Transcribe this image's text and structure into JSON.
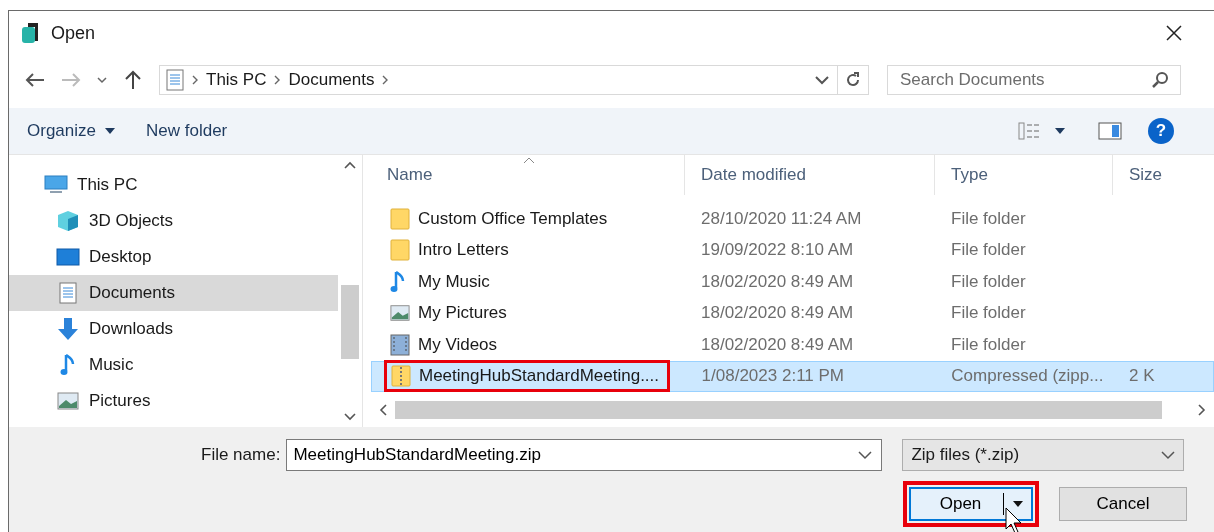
{
  "window": {
    "title": "Open"
  },
  "nav": {
    "breadcrumb": [
      "This PC",
      "Documents"
    ],
    "search": {
      "placeholder": "Search Documents"
    }
  },
  "toolbar": {
    "organize": "Organize",
    "new_folder": "New folder",
    "help": "?"
  },
  "sidebar": {
    "items": [
      {
        "label": "This PC",
        "kind": "pc",
        "selected": false,
        "children": [
          {
            "label": "3D Objects",
            "kind": "cube",
            "selected": false
          },
          {
            "label": "Desktop",
            "kind": "desktop",
            "selected": false
          },
          {
            "label": "Documents",
            "kind": "document",
            "selected": true
          },
          {
            "label": "Downloads",
            "kind": "download",
            "selected": false
          },
          {
            "label": "Music",
            "kind": "music",
            "selected": false
          },
          {
            "label": "Pictures",
            "kind": "pictures",
            "selected": false
          }
        ]
      }
    ]
  },
  "table": {
    "columns": [
      "Name",
      "Date modified",
      "Type",
      "Size"
    ],
    "rows": [
      {
        "name": "Custom Office Templates",
        "date": "28/10/2020 11:24 AM",
        "type": "File folder",
        "kind": "folder",
        "selected": false,
        "highlighted": false
      },
      {
        "name": "Intro Letters",
        "date": "19/09/2022 8:10 AM",
        "type": "File folder",
        "kind": "folder",
        "selected": false,
        "highlighted": false
      },
      {
        "name": "My Music",
        "date": "18/02/2020 8:49 AM",
        "type": "File folder",
        "kind": "music",
        "selected": false,
        "highlighted": false
      },
      {
        "name": "My Pictures",
        "date": "18/02/2020 8:49 AM",
        "type": "File folder",
        "kind": "pictures",
        "selected": false,
        "highlighted": false
      },
      {
        "name": "My Videos",
        "date": "18/02/2020 8:49 AM",
        "type": "File folder",
        "kind": "videos",
        "selected": false,
        "highlighted": false
      },
      {
        "name": "MeetingHubStandardMeeting....",
        "date": "1/08/2023 2:11 PM",
        "type": "Compressed (zipp...",
        "size": "2 K",
        "kind": "zip",
        "selected": true,
        "highlighted": true
      }
    ]
  },
  "footer": {
    "file_name_label": "File name:",
    "file_name": "MeetingHubStandardMeeting.zip",
    "file_type": "Zip files (*.zip)",
    "buttons": [
      {
        "label": "Open",
        "kind": "split",
        "highlighted": true
      },
      {
        "label": "Cancel",
        "kind": "plain",
        "highlighted": false
      }
    ]
  }
}
